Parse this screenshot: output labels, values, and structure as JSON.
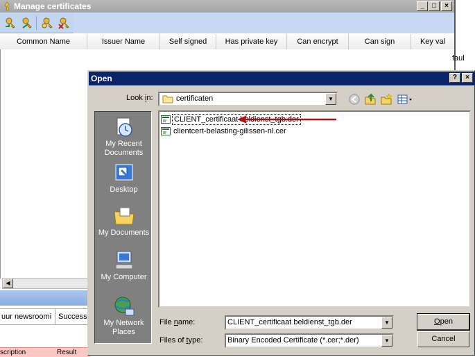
{
  "bg_window": {
    "title": "Manage certificates",
    "columns": [
      "Common Name",
      "Issuer Name",
      "Self signed",
      "Has private key",
      "Can encrypt",
      "Can sign",
      "Key val"
    ],
    "cut_cell": "faul",
    "grid2": [
      "uur newsroomi",
      "Success"
    ],
    "grid3": [
      "scription",
      "Result"
    ]
  },
  "dialog": {
    "title": "Open",
    "help": "?",
    "close": "×",
    "look_in_label_pre": "Look ",
    "look_in_label_u": "i",
    "look_in_label_post": "n:",
    "look_in_value": "certificaten",
    "places": [
      {
        "line1": "My Recent",
        "line2": "Documents"
      },
      {
        "line1": "Desktop",
        "line2": ""
      },
      {
        "line1": "My Documents",
        "line2": ""
      },
      {
        "line1": "My Computer",
        "line2": ""
      },
      {
        "line1": "My Network",
        "line2": "Places"
      }
    ],
    "files": [
      {
        "name": "CLIENT_certificaat beldienst_tgb.der",
        "selected": true
      },
      {
        "name": "clientcert-belasting-gilissen-nl.cer",
        "selected": false
      }
    ],
    "file_name_label_pre": "File ",
    "file_name_label_u": "n",
    "file_name_label_post": "ame:",
    "file_name_value": "CLIENT_certificaat beldienst_tgb.der",
    "file_type_label_pre": "Files of ",
    "file_type_label_u": "t",
    "file_type_label_post": "ype:",
    "file_type_value": "Binary Encoded Certificate (*.cer;*.der)",
    "open_pre": "",
    "open_u": "O",
    "open_post": "pen",
    "cancel_label": "Cancel"
  },
  "colors": {
    "title_active": "#0a246a",
    "face": "#d4d0c8",
    "annotation_arrow": "#b01010"
  }
}
